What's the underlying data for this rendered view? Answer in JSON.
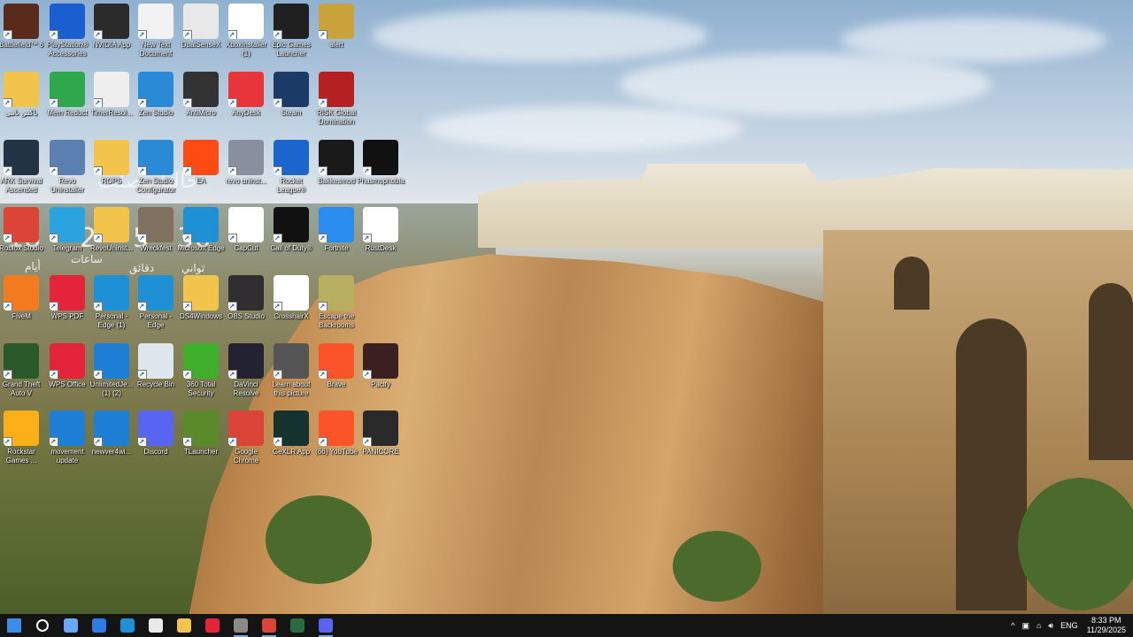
{
  "desktop": {
    "icons": [
      {
        "label": "Battlefield™ 6",
        "icon": "battlefield-icon",
        "color": "#5a2a1a"
      },
      {
        "label": "PlayStation® Accessories",
        "icon": "playstation-icon",
        "color": "#1a5fd0"
      },
      {
        "label": "NVIDIA App",
        "icon": "nvidia-icon",
        "color": "#2b2b2b"
      },
      {
        "label": "New Text Document",
        "icon": "text-document-icon",
        "color": "#f2f2f2"
      },
      {
        "label": "DualSenseX",
        "icon": "dualsensex-icon",
        "color": "#e8e8e8"
      },
      {
        "label": "XboxInstaller (1)",
        "icon": "xbox-icon",
        "color": "#ffffff"
      },
      {
        "label": "Epic Games Launcher",
        "icon": "epic-games-icon",
        "color": "#202020"
      },
      {
        "label": "alert",
        "icon": "alert-archive-icon",
        "color": "#c9a23a"
      },
      {
        "label": "باکس نامی",
        "icon": "folder-icon",
        "color": "#f3c44b"
      },
      {
        "label": "Mem Reduct",
        "icon": "mem-reduct-icon",
        "color": "#2ea84a"
      },
      {
        "label": "TimerResol...",
        "icon": "timer-icon",
        "color": "#eeeeee"
      },
      {
        "label": "Zen Studio",
        "icon": "zen-studio-icon",
        "color": "#2a8ad6"
      },
      {
        "label": "AntiMicro",
        "icon": "antimicro-icon",
        "color": "#333333"
      },
      {
        "label": "AnyDesk",
        "icon": "anydesk-icon",
        "color": "#e8343b"
      },
      {
        "label": "Steam",
        "icon": "steam-icon",
        "color": "#1b3a66"
      },
      {
        "label": "RISK Global Domination",
        "icon": "risk-icon",
        "color": "#b52020"
      },
      {
        "label": "ARK Survival Ascended",
        "icon": "ark-icon",
        "color": "#223344"
      },
      {
        "label": "Revo Uninstaller",
        "icon": "revo-icon",
        "color": "#5b7fb0"
      },
      {
        "label": "ROPS",
        "icon": "folder-icon",
        "color": "#f3c44b"
      },
      {
        "label": "Zen Studio Configurator",
        "icon": "zen-config-icon",
        "color": "#2a8ad6"
      },
      {
        "label": "EA",
        "icon": "ea-icon",
        "color": "#ff4a14"
      },
      {
        "label": "revo uninst...",
        "icon": "revo-icon",
        "color": "#8890a0"
      },
      {
        "label": "Rocket League®",
        "icon": "rocket-league-icon",
        "color": "#1a66cc"
      },
      {
        "label": "Bakkesmod",
        "icon": "bakkesmod-icon",
        "color": "#1a1a1a"
      },
      {
        "label": "Phasmophobia",
        "icon": "phasmophobia-icon",
        "color": "#111111"
      },
      {
        "label": "Roblox Studio",
        "icon": "chrome-icon",
        "color": "#db4437"
      },
      {
        "label": "Telegram",
        "icon": "telegram-icon",
        "color": "#2aa3de"
      },
      {
        "label": "RevoUninst...",
        "icon": "folder-icon",
        "color": "#f3c44b"
      },
      {
        "label": "Wreckfest",
        "icon": "wreckfest-icon",
        "color": "#807060"
      },
      {
        "label": "Microsoft Edge",
        "icon": "edge-icon",
        "color": "#1e90d6"
      },
      {
        "label": "CapCut",
        "icon": "capcut-icon",
        "color": "#ffffff"
      },
      {
        "label": "Call of Duty®",
        "icon": "call-of-duty-icon",
        "color": "#111111"
      },
      {
        "label": "Fortnite",
        "icon": "fortnite-icon",
        "color": "#2b8cf0"
      },
      {
        "label": "RustDesk",
        "icon": "rustdesk-icon",
        "color": "#ffffff"
      },
      {
        "label": "FiveM",
        "icon": "fivem-icon",
        "color": "#f47a1f"
      },
      {
        "label": "WPS PDF",
        "icon": "wps-pdf-icon",
        "color": "#e3243b"
      },
      {
        "label": "Personal - Edge (1)",
        "icon": "edge-icon",
        "color": "#1e90d6"
      },
      {
        "label": "Personal - Edge",
        "icon": "edge-icon",
        "color": "#1e90d6"
      },
      {
        "label": "DS4Windows",
        "icon": "folder-icon",
        "color": "#f3c44b"
      },
      {
        "label": "OBS Studio",
        "icon": "obs-icon",
        "color": "#302e31"
      },
      {
        "label": "CrosshairX",
        "icon": "crosshairx-icon",
        "color": "#ffffff"
      },
      {
        "label": "Escape the Backrooms",
        "icon": "backrooms-icon",
        "color": "#b8b060"
      },
      {
        "label": "Grand Theft Auto V",
        "icon": "gta-v-icon",
        "color": "#2a5a2a"
      },
      {
        "label": "WPS Office",
        "icon": "wps-office-icon",
        "color": "#e3243b"
      },
      {
        "label": "UnlimitedJe... (1) (2)",
        "icon": "ie-icon",
        "color": "#1e7fd6"
      },
      {
        "label": "Recycle Bin",
        "icon": "recycle-bin-icon",
        "color": "#dfe7ee"
      },
      {
        "label": "360 Total Security",
        "icon": "360-security-icon",
        "color": "#3fae2a"
      },
      {
        "label": "DaVinci Resolve",
        "icon": "davinci-icon",
        "color": "#222233"
      },
      {
        "label": "Learn about this picture",
        "icon": "learn-picture-icon",
        "color": "#555555"
      },
      {
        "label": "Brave",
        "icon": "brave-icon",
        "color": "#fb542b"
      },
      {
        "label": "Pacify",
        "icon": "pacify-icon",
        "color": "#3a2020"
      },
      {
        "label": "Rockstar Games ...",
        "icon": "rockstar-icon",
        "color": "#fcaf17"
      },
      {
        "label": "movement update",
        "icon": "ie-icon",
        "color": "#1e7fd6"
      },
      {
        "label": "newver4wi...",
        "icon": "ie-icon",
        "color": "#1e7fd6"
      },
      {
        "label": "Discord",
        "icon": "discord-icon",
        "color": "#5865f2"
      },
      {
        "label": "TLauncher",
        "icon": "tlauncher-icon",
        "color": "#5a8a2a"
      },
      {
        "label": "Google Chrome",
        "icon": "chrome-icon",
        "color": "#db4437"
      },
      {
        "label": "GeXLR App",
        "icon": "gexlr-icon",
        "color": "#14332e"
      },
      {
        "label": "(66) YouTube",
        "icon": "brave-icon",
        "color": "#fb542b"
      },
      {
        "label": "PANICORE",
        "icon": "panicore-icon",
        "color": "#2a2a2a"
      }
    ]
  },
  "widget": {
    "title": "حالياً وصلت",
    "days": "18",
    "days_unit": "أيام",
    "hours": "2",
    "hours_unit": "ساعات",
    "minutes": "5",
    "minutes_unit": "دقائق",
    "seconds": "36",
    "seconds_unit": "ثواني"
  },
  "taskbar": {
    "buttons": [
      {
        "name": "start-button",
        "icon": "windows-icon",
        "color": "#3b8ee8"
      },
      {
        "name": "search-button",
        "icon": "search-icon",
        "color": "#ffffff"
      },
      {
        "name": "copilot-button",
        "icon": "copilot-icon",
        "color": "#6aa8ff"
      },
      {
        "name": "mail-button",
        "icon": "mail-icon",
        "color": "#2d7be5"
      },
      {
        "name": "edge-taskbar-button",
        "icon": "edge-icon",
        "color": "#1e90d6"
      },
      {
        "name": "store-button",
        "icon": "store-icon",
        "color": "#e9e9e9"
      },
      {
        "name": "file-explorer-button",
        "icon": "folder-icon",
        "color": "#f3c44b"
      },
      {
        "name": "wps-taskbar-button",
        "icon": "wps-office-icon",
        "color": "#e3243b"
      },
      {
        "name": "steam-taskbar-button",
        "icon": "steam-icon",
        "color": "#8a8a8a",
        "active": true
      },
      {
        "name": "chrome-taskbar-button",
        "icon": "chrome-icon",
        "color": "#db4437",
        "active": true
      },
      {
        "name": "xbox-taskbar-button",
        "icon": "xbox-icon",
        "color": "#2c6b3f"
      },
      {
        "name": "discord-taskbar-button",
        "icon": "discord-icon",
        "color": "#5865f2",
        "active": true
      }
    ],
    "tray": {
      "chevron": "^",
      "language": "ENG",
      "time": "8:33 PM",
      "date": "11/29/2025"
    }
  }
}
